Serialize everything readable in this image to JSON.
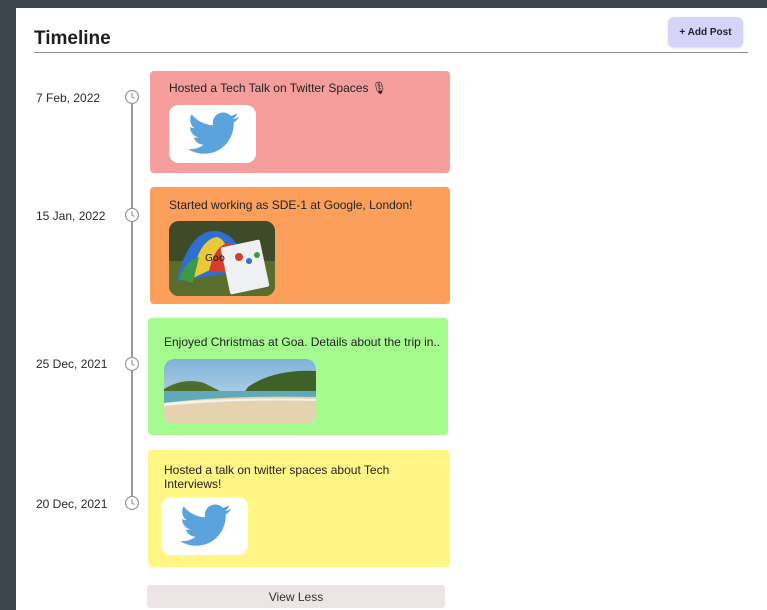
{
  "header": {
    "title": "Timeline",
    "add_post_label": "+ Add Post"
  },
  "colors": {
    "card1": "#f59e9c",
    "card2": "#fb9f5b",
    "card3": "#a5fb8d",
    "card4": "#fff685",
    "twitter_blue": "#5aa3dd",
    "add_button_bg": "#d6d4fb"
  },
  "posts": [
    {
      "date": "7 Feb, 2022",
      "text": "Hosted a Tech Talk on Twitter Spaces 🎙",
      "image_icon": "twitter-bird-icon"
    },
    {
      "date": "15 Jan, 2022",
      "text": "Started working as SDE-1 at Google, London!",
      "image_icon": "google-photo"
    },
    {
      "date": "25 Dec, 2021",
      "text": "Enjoyed Christmas at Goa. Details about the trip in..",
      "image_icon": "beach-photo"
    },
    {
      "date": "20 Dec, 2021",
      "text": "Hosted a talk on twitter spaces about Tech Interviews!",
      "image_icon": "twitter-bird-icon"
    }
  ],
  "footer": {
    "view_less_label": "View Less"
  }
}
